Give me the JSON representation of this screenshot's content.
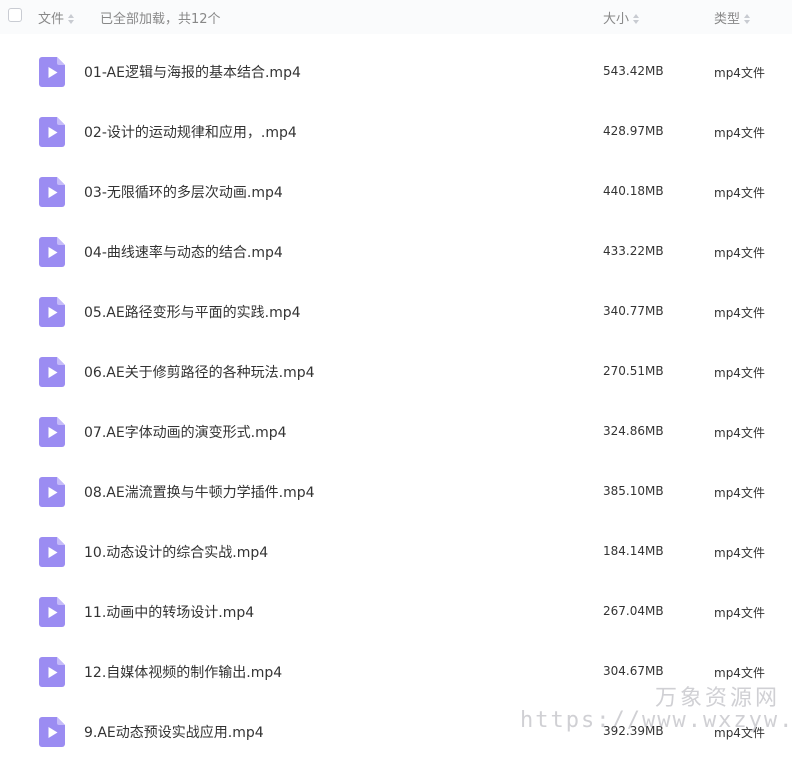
{
  "header": {
    "col_file": "文件",
    "loaded_status": "已全部加载，共12个",
    "col_size": "大小",
    "col_type": "类型"
  },
  "icons": {
    "file": "video-file-icon",
    "sort": "sort-icon",
    "checkbox": "checkbox-icon"
  },
  "colors": {
    "video_icon": "#9b8cf2",
    "video_icon_fold": "#c6bcf9"
  },
  "files": [
    {
      "name": "01-AE逻辑与海报的基本结合.mp4",
      "size": "543.42MB",
      "type": "mp4文件"
    },
    {
      "name": "02-设计的运动规律和应用，.mp4",
      "size": "428.97MB",
      "type": "mp4文件"
    },
    {
      "name": "03-无限循环的多层次动画.mp4",
      "size": "440.18MB",
      "type": "mp4文件"
    },
    {
      "name": "04-曲线速率与动态的结合.mp4",
      "size": "433.22MB",
      "type": "mp4文件"
    },
    {
      "name": "05.AE路径变形与平面的实践.mp4",
      "size": "340.77MB",
      "type": "mp4文件"
    },
    {
      "name": "06.AE关于修剪路径的各种玩法.mp4",
      "size": "270.51MB",
      "type": "mp4文件"
    },
    {
      "name": "07.AE字体动画的演变形式.mp4",
      "size": "324.86MB",
      "type": "mp4文件"
    },
    {
      "name": "08.AE湍流置换与牛顿力学插件.mp4",
      "size": "385.10MB",
      "type": "mp4文件"
    },
    {
      "name": "10.动态设计的综合实战.mp4",
      "size": "184.14MB",
      "type": "mp4文件"
    },
    {
      "name": "11.动画中的转场设计.mp4",
      "size": "267.04MB",
      "type": "mp4文件"
    },
    {
      "name": "12.自媒体视频的制作输出.mp4",
      "size": "304.67MB",
      "type": "mp4文件"
    },
    {
      "name": "9.AE动态预设实战应用.mp4",
      "size": "392.39MB",
      "type": "mp4文件"
    }
  ],
  "watermark": {
    "line1": "万象资源网",
    "line2": "https://www.wxzyw.cn"
  }
}
